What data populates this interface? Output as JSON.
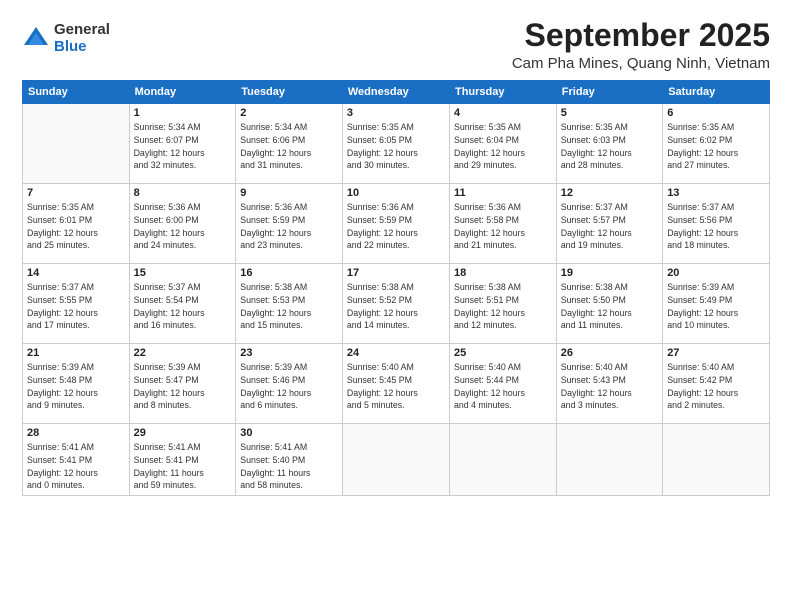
{
  "header": {
    "logo_general": "General",
    "logo_blue": "Blue",
    "month": "September 2025",
    "location": "Cam Pha Mines, Quang Ninh, Vietnam"
  },
  "weekdays": [
    "Sunday",
    "Monday",
    "Tuesday",
    "Wednesday",
    "Thursday",
    "Friday",
    "Saturday"
  ],
  "weeks": [
    [
      {
        "day": "",
        "info": ""
      },
      {
        "day": "1",
        "info": "Sunrise: 5:34 AM\nSunset: 6:07 PM\nDaylight: 12 hours\nand 32 minutes."
      },
      {
        "day": "2",
        "info": "Sunrise: 5:34 AM\nSunset: 6:06 PM\nDaylight: 12 hours\nand 31 minutes."
      },
      {
        "day": "3",
        "info": "Sunrise: 5:35 AM\nSunset: 6:05 PM\nDaylight: 12 hours\nand 30 minutes."
      },
      {
        "day": "4",
        "info": "Sunrise: 5:35 AM\nSunset: 6:04 PM\nDaylight: 12 hours\nand 29 minutes."
      },
      {
        "day": "5",
        "info": "Sunrise: 5:35 AM\nSunset: 6:03 PM\nDaylight: 12 hours\nand 28 minutes."
      },
      {
        "day": "6",
        "info": "Sunrise: 5:35 AM\nSunset: 6:02 PM\nDaylight: 12 hours\nand 27 minutes."
      }
    ],
    [
      {
        "day": "7",
        "info": "Sunrise: 5:35 AM\nSunset: 6:01 PM\nDaylight: 12 hours\nand 25 minutes."
      },
      {
        "day": "8",
        "info": "Sunrise: 5:36 AM\nSunset: 6:00 PM\nDaylight: 12 hours\nand 24 minutes."
      },
      {
        "day": "9",
        "info": "Sunrise: 5:36 AM\nSunset: 5:59 PM\nDaylight: 12 hours\nand 23 minutes."
      },
      {
        "day": "10",
        "info": "Sunrise: 5:36 AM\nSunset: 5:59 PM\nDaylight: 12 hours\nand 22 minutes."
      },
      {
        "day": "11",
        "info": "Sunrise: 5:36 AM\nSunset: 5:58 PM\nDaylight: 12 hours\nand 21 minutes."
      },
      {
        "day": "12",
        "info": "Sunrise: 5:37 AM\nSunset: 5:57 PM\nDaylight: 12 hours\nand 19 minutes."
      },
      {
        "day": "13",
        "info": "Sunrise: 5:37 AM\nSunset: 5:56 PM\nDaylight: 12 hours\nand 18 minutes."
      }
    ],
    [
      {
        "day": "14",
        "info": "Sunrise: 5:37 AM\nSunset: 5:55 PM\nDaylight: 12 hours\nand 17 minutes."
      },
      {
        "day": "15",
        "info": "Sunrise: 5:37 AM\nSunset: 5:54 PM\nDaylight: 12 hours\nand 16 minutes."
      },
      {
        "day": "16",
        "info": "Sunrise: 5:38 AM\nSunset: 5:53 PM\nDaylight: 12 hours\nand 15 minutes."
      },
      {
        "day": "17",
        "info": "Sunrise: 5:38 AM\nSunset: 5:52 PM\nDaylight: 12 hours\nand 14 minutes."
      },
      {
        "day": "18",
        "info": "Sunrise: 5:38 AM\nSunset: 5:51 PM\nDaylight: 12 hours\nand 12 minutes."
      },
      {
        "day": "19",
        "info": "Sunrise: 5:38 AM\nSunset: 5:50 PM\nDaylight: 12 hours\nand 11 minutes."
      },
      {
        "day": "20",
        "info": "Sunrise: 5:39 AM\nSunset: 5:49 PM\nDaylight: 12 hours\nand 10 minutes."
      }
    ],
    [
      {
        "day": "21",
        "info": "Sunrise: 5:39 AM\nSunset: 5:48 PM\nDaylight: 12 hours\nand 9 minutes."
      },
      {
        "day": "22",
        "info": "Sunrise: 5:39 AM\nSunset: 5:47 PM\nDaylight: 12 hours\nand 8 minutes."
      },
      {
        "day": "23",
        "info": "Sunrise: 5:39 AM\nSunset: 5:46 PM\nDaylight: 12 hours\nand 6 minutes."
      },
      {
        "day": "24",
        "info": "Sunrise: 5:40 AM\nSunset: 5:45 PM\nDaylight: 12 hours\nand 5 minutes."
      },
      {
        "day": "25",
        "info": "Sunrise: 5:40 AM\nSunset: 5:44 PM\nDaylight: 12 hours\nand 4 minutes."
      },
      {
        "day": "26",
        "info": "Sunrise: 5:40 AM\nSunset: 5:43 PM\nDaylight: 12 hours\nand 3 minutes."
      },
      {
        "day": "27",
        "info": "Sunrise: 5:40 AM\nSunset: 5:42 PM\nDaylight: 12 hours\nand 2 minutes."
      }
    ],
    [
      {
        "day": "28",
        "info": "Sunrise: 5:41 AM\nSunset: 5:41 PM\nDaylight: 12 hours\nand 0 minutes."
      },
      {
        "day": "29",
        "info": "Sunrise: 5:41 AM\nSunset: 5:41 PM\nDaylight: 11 hours\nand 59 minutes."
      },
      {
        "day": "30",
        "info": "Sunrise: 5:41 AM\nSunset: 5:40 PM\nDaylight: 11 hours\nand 58 minutes."
      },
      {
        "day": "",
        "info": ""
      },
      {
        "day": "",
        "info": ""
      },
      {
        "day": "",
        "info": ""
      },
      {
        "day": "",
        "info": ""
      }
    ]
  ]
}
